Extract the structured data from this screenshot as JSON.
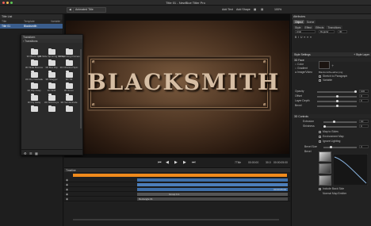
{
  "window": {
    "title": "Title 01 - NewBlue Titler Pro"
  },
  "toolbar": {
    "animated_title": "Animated Title",
    "add_text": "Add Text",
    "add_shape": "Add Shape",
    "zoom": "100%"
  },
  "title_list": {
    "header": "Title List",
    "columns": [
      "Title",
      "Template",
      "Variable"
    ],
    "rows": [
      {
        "title": "Title 01",
        "template": "Blacksmith",
        "variable": ""
      }
    ]
  },
  "transitions": {
    "header": "Transform",
    "nav_label": "Transitions",
    "items": [
      "3D Block Split",
      "3D Slide Spinning Cubes",
      "3D Spinning Frames",
      "3D Slide Bounce",
      "3D Box Flip",
      "3D Channel Spin",
      "3D Flip Cascade",
      "3D Stagger",
      "3D Tilt",
      "3D Flip Away",
      "3D Shift",
      "3D Zoom",
      "3D Fly Away",
      "3D Shift Keys",
      "3D Vert Extrude",
      "",
      "",
      ""
    ]
  },
  "canvas": {
    "title_text": "BLACKSMITH"
  },
  "transport": {
    "time_label": "7Title",
    "current": "00:00:00",
    "rate": "30.0",
    "duration": "00:00:05:00"
  },
  "timeline": {
    "header": "Timeline",
    "tracks": [
      {
        "label": "",
        "bar": ""
      },
      {
        "label": "",
        "bar": ""
      },
      {
        "label": "",
        "bar": "00:00:05:00"
      },
      {
        "label": "",
        "bar": "Group 0-1"
      },
      {
        "label": "",
        "bar": "Rectangle 01"
      }
    ]
  },
  "properties": {
    "header": "Attributes",
    "mode_tabs": [
      "Object",
      "Scene"
    ],
    "tabs": [
      "Style",
      "Effect",
      "Effects",
      "Transitions"
    ],
    "font": "Arial",
    "font_style": "Regular",
    "font_size": "30",
    "style_settings": "Style Settings",
    "style_layer": "+ Style Layer",
    "face_section": "3D Face",
    "face_options": [
      "Color",
      "Gradient",
      "Image/Video"
    ],
    "texture_file": "BlacksmithLeather.png",
    "stretch": "Stretch to Paragraph",
    "variable": "Variable",
    "opacity_label": "Opacity",
    "opacity": "100",
    "offset_label": "Offset",
    "offset": "0",
    "depth_label": "Layer Depth",
    "depth": "0",
    "bevel_label": "Bevel",
    "controls_section": "3D Controls",
    "extrude_label": "Extrusion",
    "extrude": "10",
    "shininess_label": "Shininess",
    "shininess": "0",
    "map_to_sides": "Map to Sides",
    "environment_map": "Environment Map",
    "ignore_lighting": "Ignore Lighting",
    "bevel_size_label": "Bevel Size",
    "bevel_size": "4",
    "bevel_shape_label": "Bevel",
    "include_back_side": "Include Back Side",
    "normal_map": "Normal Map Emitter"
  }
}
